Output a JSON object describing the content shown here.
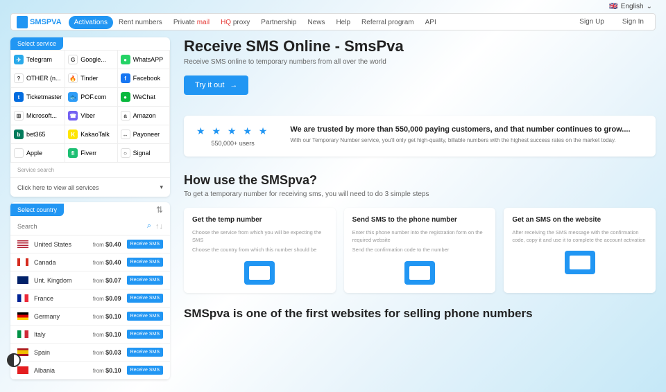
{
  "topbar": {
    "lang": "English"
  },
  "nav": {
    "logo": "SMSPVA",
    "items": [
      "Activations",
      "Rent numbers",
      "Private mail",
      "HQ proxy",
      "Partnership",
      "News",
      "Help",
      "Referral program",
      "API"
    ],
    "signup": "Sign Up",
    "signin": "Sign In"
  },
  "services": {
    "tab": "Select service",
    "items": [
      {
        "name": "Telegram",
        "bg": "#29a9ea",
        "t": "✈"
      },
      {
        "name": "Google...",
        "bg": "#fff",
        "t": "G"
      },
      {
        "name": "WhatsAPP",
        "bg": "#25d366",
        "t": "●"
      },
      {
        "name": "OTHER (n...",
        "bg": "#fff",
        "t": "?"
      },
      {
        "name": "Tinder",
        "bg": "#fff",
        "t": "🔥"
      },
      {
        "name": "Facebook",
        "bg": "#1877f2",
        "t": "f"
      },
      {
        "name": "Ticketmaster",
        "bg": "#026cdf",
        "t": "t"
      },
      {
        "name": "POF.com",
        "bg": "#2e9df7",
        "t": "🐟"
      },
      {
        "name": "WeChat",
        "bg": "#09b83e",
        "t": "●"
      },
      {
        "name": "Microsoft...",
        "bg": "#fff",
        "t": "⊞"
      },
      {
        "name": "Viber",
        "bg": "#7360f2",
        "t": "☎"
      },
      {
        "name": "Amazon",
        "bg": "#fff",
        "t": "a"
      },
      {
        "name": "bet365",
        "bg": "#027b5b",
        "t": "b"
      },
      {
        "name": "KakaoTalk",
        "bg": "#fee500",
        "t": "K"
      },
      {
        "name": "Payoneer",
        "bg": "#fff",
        "t": "↔"
      },
      {
        "name": "Apple",
        "bg": "#fff",
        "t": ""
      },
      {
        "name": "Fiverr",
        "bg": "#1dbf73",
        "t": "fi"
      },
      {
        "name": "Signal",
        "bg": "#fff",
        "t": "○"
      }
    ],
    "search_label": "Service search",
    "dropdown": "Click here to view all services"
  },
  "countries": {
    "tab": "Select country",
    "search_ph": "Search",
    "items": [
      {
        "name": "United States",
        "price": "$0.40",
        "flag": "flag-us"
      },
      {
        "name": "Canada",
        "price": "$0.40",
        "flag": "flag-ca"
      },
      {
        "name": "Unt. Kingdom",
        "price": "$0.07",
        "flag": "flag-gb"
      },
      {
        "name": "France",
        "price": "$0.09",
        "flag": "flag-fr"
      },
      {
        "name": "Germany",
        "price": "$0.10",
        "flag": "flag-de"
      },
      {
        "name": "Italy",
        "price": "$0.10",
        "flag": "flag-it"
      },
      {
        "name": "Spain",
        "price": "$0.03",
        "flag": "flag-es"
      },
      {
        "name": "Albania",
        "price": "$0.10",
        "flag": "flag-al"
      }
    ],
    "from": "from",
    "btn": "Receive SMS"
  },
  "hero": {
    "title": "Receive SMS Online - SmsPva",
    "subtitle": "Receive SMS online to temporary numbers from all over the world",
    "btn": "Try it out"
  },
  "trust": {
    "users": "550,000+ users",
    "title": "We are trusted by more than 550,000 paying customers, and that number continues to grow....",
    "desc": "With our Temporary Number service, you'll only get high-quality, billable numbers with the highest success rates on the market today."
  },
  "how": {
    "title": "How use the SMSpva?",
    "subtitle": "To get a temporary number for receiving sms, you will need to do 3 simple steps",
    "steps": [
      {
        "title": "Get the temp number",
        "d1": "Choose the service from which you will be expecting the SMS",
        "d2": "Choose the country from which this number should be"
      },
      {
        "title": "Send SMS to the phone number",
        "d1": "Enter this phone number into the registration form on the required website",
        "d2": "Send the confirmation code to the number"
      },
      {
        "title": "Get an SMS on the website",
        "d1": "After receiving the SMS message with the confirmation code, copy it and use it to complete the account activation",
        "d2": ""
      }
    ]
  },
  "bottom": {
    "title": "SMSpva is one of the first websites for selling phone numbers"
  }
}
